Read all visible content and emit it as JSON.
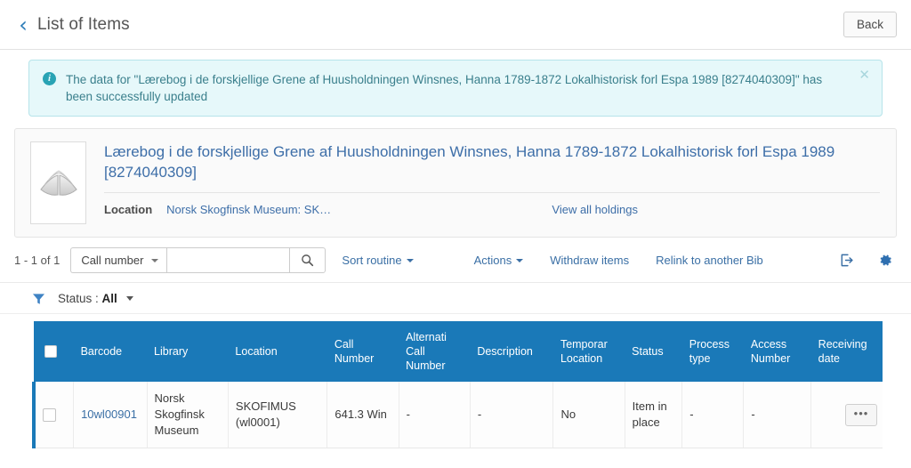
{
  "header": {
    "back_chevron_icon": "chevron-left-icon",
    "title": "List of Items",
    "back_button_label": "Back"
  },
  "alert": {
    "icon": "info-circle-icon",
    "message": "The data for \"Lærebog i de forskjellige Grene af Huusholdningen Winsnes, Hanna 1789-1872 Lokalhistorisk forl Espa 1989 [8274040309]\" has been successfully updated",
    "close_icon": "close-icon",
    "background_color": "#e6f8fa",
    "border_color": "#b6e4ea",
    "text_color": "#3a7f8c"
  },
  "record": {
    "thumbnail_icon": "open-book-placeholder-icon",
    "title": "Lærebog i de forskjellige Grene af Huusholdningen Winsnes, Hanna 1789-1872 Lokalhistorisk forl Espa 1989 [8274040309]",
    "location_label": "Location",
    "location_value": "Norsk Skogfinsk Museum: SK…",
    "view_all_holdings_label": "View all holdings"
  },
  "toolbar": {
    "count_label": "1 - 1 of 1",
    "search_field_label": "Call number",
    "search_value": "",
    "search_placeholder": "",
    "search_icon": "search-icon",
    "sort_routine_label": "Sort routine",
    "actions_label": "Actions",
    "withdraw_items_label": "Withdraw items",
    "relink_label": "Relink to another Bib",
    "export_icon": "export-icon",
    "settings_icon": "gear-icon"
  },
  "filter": {
    "funnel_icon": "filter-funnel-icon",
    "label": "Status :",
    "value": "All"
  },
  "table": {
    "header_color": "#1a79b8",
    "columns": [
      "Barcode",
      "Library",
      "Location",
      "Call Number",
      "Alternati Call Number",
      "Description",
      "Temporar Location",
      "Status",
      "Process type",
      "Access Number",
      "Receiving date"
    ],
    "rows": [
      {
        "barcode": "10wl00901",
        "library": "Norsk Skogfinsk Museum",
        "location": "SKOFIMUS (wl0001)",
        "call_number": "641.3 Win",
        "alternative_call_number": "-",
        "description": "-",
        "temporary_location": "No",
        "status": "Item in place",
        "process_type": "-",
        "access_number": "-",
        "receiving_date": "-",
        "actions_label": "•••"
      }
    ]
  }
}
